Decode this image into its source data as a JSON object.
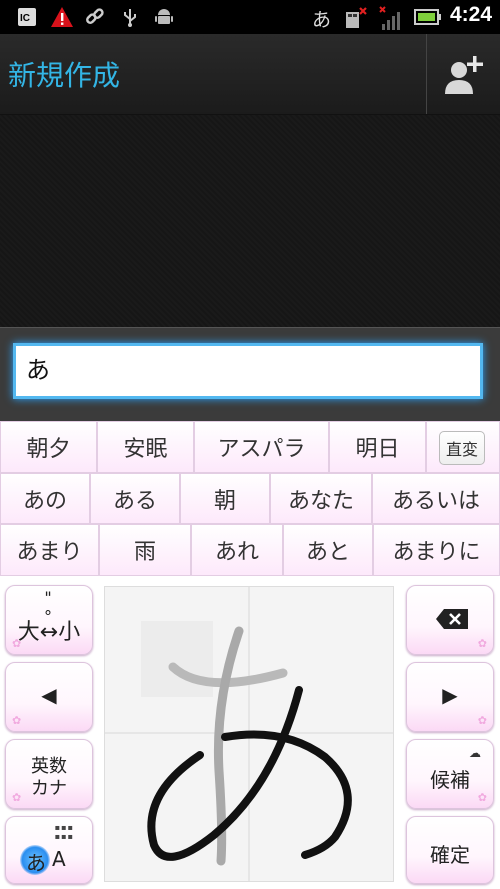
{
  "status_bar": {
    "time": "4:24",
    "ime_indicator": "あ",
    "icons": [
      "ic-badge-icon",
      "warning-icon",
      "link-icon",
      "usb-icon",
      "android-icon",
      "sd-card-icon",
      "signal-icon",
      "battery-icon"
    ]
  },
  "action_bar": {
    "title": "新規作成",
    "add_contact_icon": "add-contact-icon"
  },
  "compose": {
    "input_value": "あ"
  },
  "candidates": {
    "row1": [
      "朝夕",
      "安眠",
      "アスパラ",
      "明日"
    ],
    "convert_label": "直変",
    "row2": [
      "あの",
      "ある",
      "朝",
      "あなた",
      "あるいは"
    ],
    "row3": [
      "あまり",
      "雨",
      "あれ",
      "あと",
      "あまりに"
    ]
  },
  "keyboard": {
    "case_key": {
      "marks": "\" °",
      "label": "大↔小"
    },
    "left_label": "◀",
    "eisu_kana_line1": "英数",
    "eisu_kana_line2": "カナ",
    "mode_kana": "あ",
    "mode_alpha": "A",
    "delete_icon": "backspace-icon",
    "right_label": "▶",
    "candidates_label": "候補",
    "confirm_label": "確定"
  },
  "handwriting": {
    "stroke_char": "あ"
  },
  "colors": {
    "accent": "#33b5e5",
    "input_glow": "#53b8f0",
    "key_pink": "#fbd9f5"
  }
}
